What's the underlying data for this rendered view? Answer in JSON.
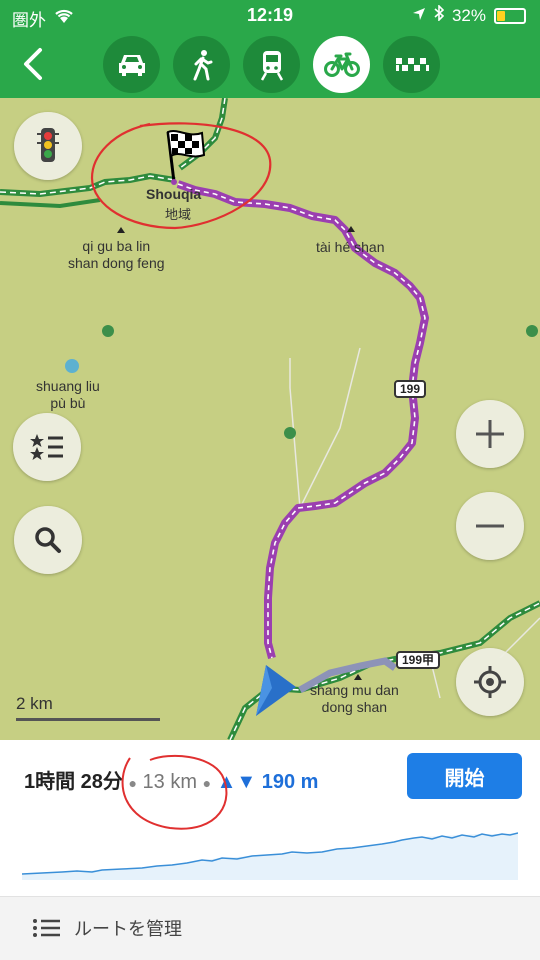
{
  "status": {
    "carrier": "圏外",
    "time": "12:19",
    "battery": "32%"
  },
  "header": {
    "modes": [
      {
        "name": "car",
        "active": false
      },
      {
        "name": "walk",
        "active": false
      },
      {
        "name": "transit",
        "active": false
      },
      {
        "name": "bike",
        "active": true
      },
      {
        "name": "taxi",
        "active": false
      }
    ]
  },
  "map": {
    "destination": {
      "name": "Shouqia",
      "sub": "地域"
    },
    "labels": {
      "qigu": "qi gu ba lin\nshan dong feng",
      "taihe": "tài hé shan",
      "shuangliu": "shuang liu\npù bù",
      "shangmu": "shang mu dan\ndong shan"
    },
    "roads": {
      "r199": "199",
      "r199b": "199甲"
    },
    "scale": "2 km"
  },
  "route": {
    "duration": "1時間 28分",
    "distance": "13 km",
    "elevation_arrows": "▲▼",
    "elevation": "190 m",
    "start_label": "開始",
    "manage_label": "ルートを管理"
  },
  "colors": {
    "header": "#2aa84a",
    "route": "#9b3fb0",
    "accent": "#1e7ee6"
  }
}
